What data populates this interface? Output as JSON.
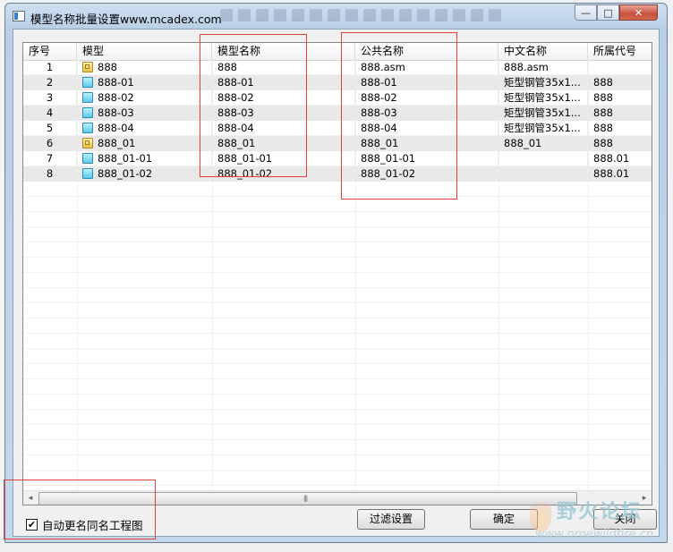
{
  "window": {
    "title": "模型名称批量设置www.mcadex.com",
    "min_glyph": "—",
    "max_glyph": "□",
    "close_glyph": "✕"
  },
  "table": {
    "columns": [
      "序号",
      "模型",
      "模型名称",
      "公共名称",
      "中文名称",
      "所属代号"
    ],
    "rows": [
      {
        "index": "1",
        "type": "asm",
        "model": "888",
        "model_name": "888",
        "common_name": "888.asm",
        "cn_name": "888.asm",
        "code": ""
      },
      {
        "index": "2",
        "type": "prt",
        "model": "888-01",
        "model_name": "888-01",
        "common_name": "888-01",
        "cn_name": "矩型钢管35x1...",
        "code": "888"
      },
      {
        "index": "3",
        "type": "prt",
        "model": "888-02",
        "model_name": "888-02",
        "common_name": "888-02",
        "cn_name": "矩型钢管35x1...",
        "code": "888"
      },
      {
        "index": "4",
        "type": "prt",
        "model": "888-03",
        "model_name": "888-03",
        "common_name": "888-03",
        "cn_name": "矩型钢管35x1...",
        "code": "888"
      },
      {
        "index": "5",
        "type": "prt",
        "model": "888-04",
        "model_name": "888-04",
        "common_name": "888-04",
        "cn_name": "矩型钢管35x1...",
        "code": "888"
      },
      {
        "index": "6",
        "type": "asm",
        "model": "888_01",
        "model_name": "888_01",
        "common_name": "888_01",
        "cn_name": "888_01",
        "code": "888"
      },
      {
        "index": "7",
        "type": "prt",
        "model": "888_01-01",
        "model_name": "888_01-01",
        "common_name": "888_01-01",
        "cn_name": "",
        "code": "888.01"
      },
      {
        "index": "8",
        "type": "prt",
        "model": "888_01-02",
        "model_name": "888_01-02",
        "common_name": "888_01-02",
        "cn_name": "",
        "code": "888.01"
      }
    ]
  },
  "scrollbar": {
    "left_arrow": "◂",
    "right_arrow": "▸",
    "grip": "|||"
  },
  "options": {
    "auto_rename_label": "自动更名同名工程图",
    "auto_rename_checked": true,
    "check_glyph": "✔"
  },
  "buttons": {
    "filter": "过滤设置",
    "ok": "确定",
    "close": "关闭"
  },
  "watermark": {
    "text": "野火论坛",
    "url": "www.proewildfire.cn"
  }
}
